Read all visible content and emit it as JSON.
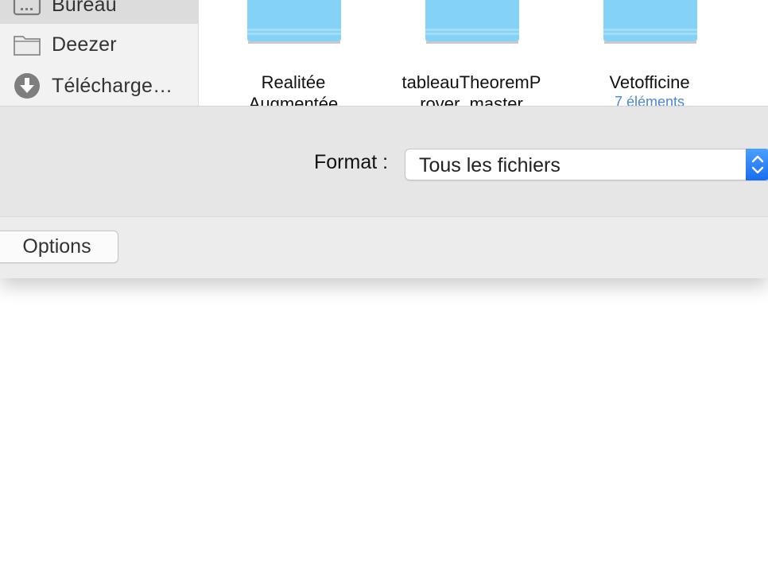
{
  "sidebar": {
    "items": [
      {
        "label": "Bureau",
        "icon": "desktop-icon",
        "selected": true
      },
      {
        "label": "Deezer",
        "icon": "folder-icon",
        "selected": false
      },
      {
        "label": "Télécharge…",
        "icon": "download-icon",
        "selected": false
      }
    ]
  },
  "files": [
    {
      "name": "Realitée",
      "name_line2": "Augmentée",
      "subtitle": ""
    },
    {
      "name": "tableauTheoremP",
      "name_line2": "rover_master",
      "subtitle": ""
    },
    {
      "name": "Vetofficine",
      "name_line2": "",
      "subtitle": "7 éléments"
    }
  ],
  "format": {
    "label": "Format :",
    "selected": "Tous les fichiers"
  },
  "buttons": {
    "options": "Options"
  },
  "colors": {
    "folder_blue": "#84d3f7",
    "accent": "#1a6cf0",
    "link_blue": "#4a86d9"
  }
}
